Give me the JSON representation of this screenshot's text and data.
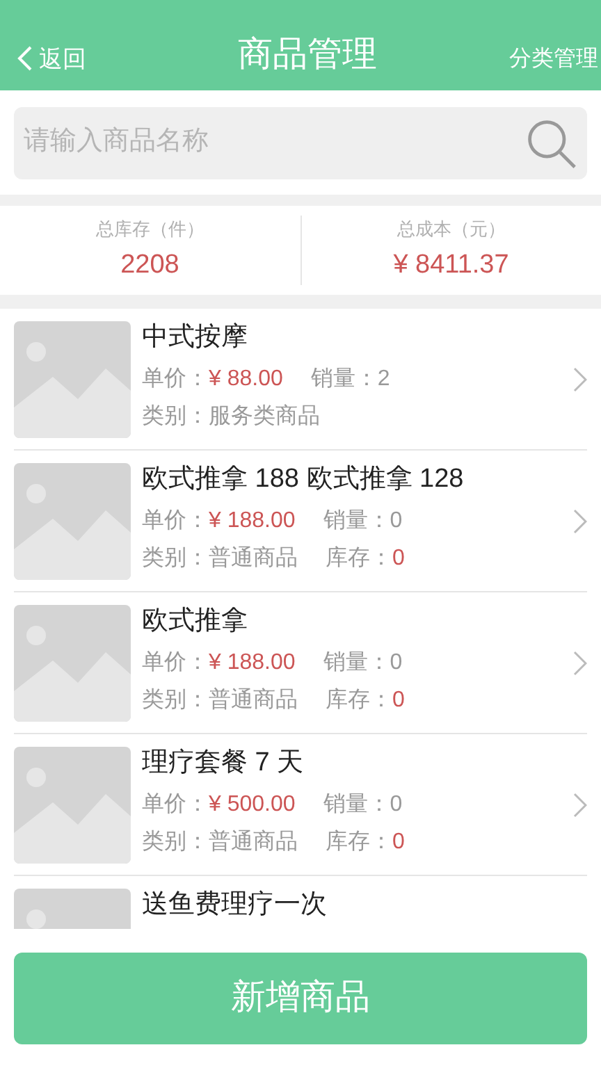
{
  "header": {
    "back": "返回",
    "title": "商品管理",
    "action": "分类管理"
  },
  "search": {
    "placeholder": "请输入商品名称"
  },
  "stats": [
    {
      "label": "总库存（件）",
      "value": "2208"
    },
    {
      "label": "总成本（元）",
      "value": "¥ 8411.37"
    }
  ],
  "products": [
    {
      "name": "中式按摩",
      "price_label": "单价：",
      "price": "¥ 88.00",
      "sales_label": "销量：",
      "sales": "2",
      "category_label": "类别：",
      "category": "服务类商品"
    },
    {
      "name": "欧式推拿 188 欧式推拿 128",
      "price_label": "单价：",
      "price": "¥ 188.00",
      "sales_label": "销量：",
      "sales": "0",
      "category_label": "类别：",
      "category": "普通商品",
      "stock_label": "库存：",
      "stock": "0"
    },
    {
      "name": "欧式推拿",
      "price_label": "单价：",
      "price": "¥ 188.00",
      "sales_label": "销量：",
      "sales": "0",
      "category_label": "类别：",
      "category": "普通商品",
      "stock_label": "库存：",
      "stock": "0"
    },
    {
      "name": "理疗套餐 7 天",
      "price_label": "单价：",
      "price": "¥ 500.00",
      "sales_label": "销量：",
      "sales": "0",
      "category_label": "类别：",
      "category": "普通商品",
      "stock_label": "库存：",
      "stock": "0"
    },
    {
      "name": "送鱼费理疗一次"
    }
  ],
  "add_button": "新增商品"
}
